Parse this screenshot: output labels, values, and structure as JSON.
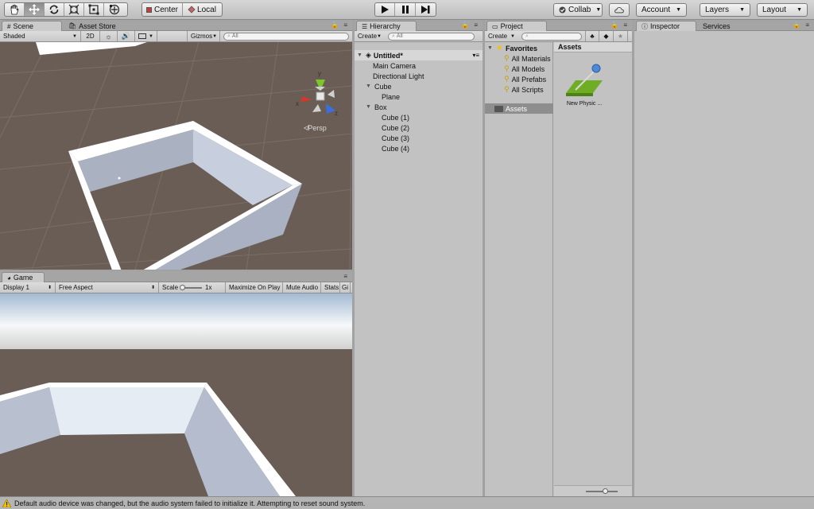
{
  "toolbar": {
    "pivot_label": "Center",
    "space_label": "Local",
    "collab_label": "Collab",
    "account_label": "Account",
    "layers_label": "Layers",
    "layout_label": "Layout"
  },
  "scene": {
    "tabs": [
      "Scene",
      "Asset Store"
    ],
    "shading": "Shaded",
    "mode_2d": "2D",
    "gizmos": "Gizmos",
    "search_placeholder": "All",
    "persp_label": "Persp",
    "axis_labels": {
      "x": "x",
      "y": "y",
      "z": "z"
    }
  },
  "game": {
    "tab": "Game",
    "display": "Display 1",
    "aspect": "Free Aspect",
    "scale_label": "Scale",
    "scale_value": "1x",
    "maximize": "Maximize On Play",
    "mute": "Mute Audio",
    "stats": "Stats",
    "gizmos": "Gi"
  },
  "hierarchy": {
    "tab": "Hierarchy",
    "create": "Create",
    "search_placeholder": "All",
    "scene_name": "Untitled*",
    "items": [
      "Main Camera",
      "Directional Light",
      "Cube",
      "Plane",
      "Box",
      "Cube (1)",
      "Cube (2)",
      "Cube (3)",
      "Cube (4)"
    ]
  },
  "project": {
    "tab": "Project",
    "create": "Create",
    "favorites_label": "Favorites",
    "favorites": [
      "All Materials",
      "All Models",
      "All Prefabs",
      "All Scripts"
    ],
    "assets_folder": "Assets",
    "assets_header": "Assets",
    "asset_items": [
      "New Physic ..."
    ]
  },
  "inspector": {
    "tabs": [
      "Inspector",
      "Services"
    ]
  },
  "status": {
    "message": "Default audio device was changed, but the audio system failed to initialize it. Attempting to reset sound system."
  },
  "colors": {
    "accent_selection": "#8a8a8a",
    "sky_top": "#a3b9d2",
    "ground": "#695b54",
    "gizmo_x": "#d8362a",
    "gizmo_y": "#7cc52b",
    "gizmo_z": "#3b6fe0",
    "warning": "#f0c20b"
  }
}
